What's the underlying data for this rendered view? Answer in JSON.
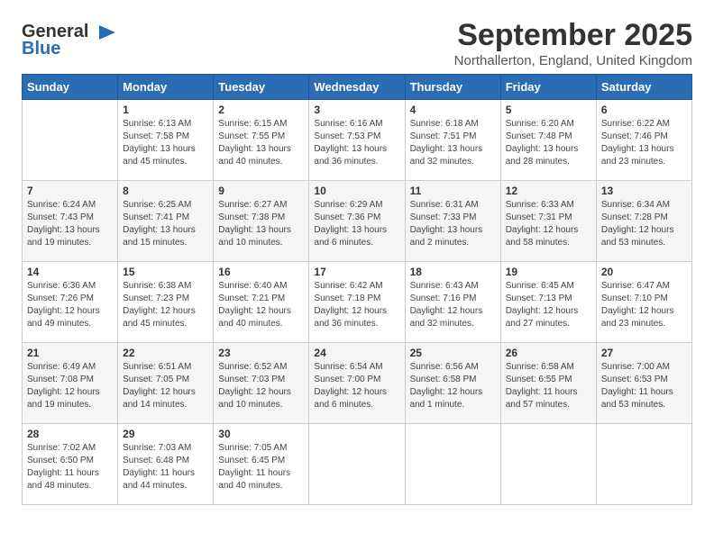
{
  "header": {
    "logo_general": "General",
    "logo_blue": "Blue",
    "month_title": "September 2025",
    "location": "Northallerton, England, United Kingdom"
  },
  "days_of_week": [
    "Sunday",
    "Monday",
    "Tuesday",
    "Wednesday",
    "Thursday",
    "Friday",
    "Saturday"
  ],
  "weeks": [
    [
      {
        "day": "",
        "sunrise": "",
        "sunset": "",
        "daylight": ""
      },
      {
        "day": "1",
        "sunrise": "Sunrise: 6:13 AM",
        "sunset": "Sunset: 7:58 PM",
        "daylight": "Daylight: 13 hours and 45 minutes."
      },
      {
        "day": "2",
        "sunrise": "Sunrise: 6:15 AM",
        "sunset": "Sunset: 7:55 PM",
        "daylight": "Daylight: 13 hours and 40 minutes."
      },
      {
        "day": "3",
        "sunrise": "Sunrise: 6:16 AM",
        "sunset": "Sunset: 7:53 PM",
        "daylight": "Daylight: 13 hours and 36 minutes."
      },
      {
        "day": "4",
        "sunrise": "Sunrise: 6:18 AM",
        "sunset": "Sunset: 7:51 PM",
        "daylight": "Daylight: 13 hours and 32 minutes."
      },
      {
        "day": "5",
        "sunrise": "Sunrise: 6:20 AM",
        "sunset": "Sunset: 7:48 PM",
        "daylight": "Daylight: 13 hours and 28 minutes."
      },
      {
        "day": "6",
        "sunrise": "Sunrise: 6:22 AM",
        "sunset": "Sunset: 7:46 PM",
        "daylight": "Daylight: 13 hours and 23 minutes."
      }
    ],
    [
      {
        "day": "7",
        "sunrise": "Sunrise: 6:24 AM",
        "sunset": "Sunset: 7:43 PM",
        "daylight": "Daylight: 13 hours and 19 minutes."
      },
      {
        "day": "8",
        "sunrise": "Sunrise: 6:25 AM",
        "sunset": "Sunset: 7:41 PM",
        "daylight": "Daylight: 13 hours and 15 minutes."
      },
      {
        "day": "9",
        "sunrise": "Sunrise: 6:27 AM",
        "sunset": "Sunset: 7:38 PM",
        "daylight": "Daylight: 13 hours and 10 minutes."
      },
      {
        "day": "10",
        "sunrise": "Sunrise: 6:29 AM",
        "sunset": "Sunset: 7:36 PM",
        "daylight": "Daylight: 13 hours and 6 minutes."
      },
      {
        "day": "11",
        "sunrise": "Sunrise: 6:31 AM",
        "sunset": "Sunset: 7:33 PM",
        "daylight": "Daylight: 13 hours and 2 minutes."
      },
      {
        "day": "12",
        "sunrise": "Sunrise: 6:33 AM",
        "sunset": "Sunset: 7:31 PM",
        "daylight": "Daylight: 12 hours and 58 minutes."
      },
      {
        "day": "13",
        "sunrise": "Sunrise: 6:34 AM",
        "sunset": "Sunset: 7:28 PM",
        "daylight": "Daylight: 12 hours and 53 minutes."
      }
    ],
    [
      {
        "day": "14",
        "sunrise": "Sunrise: 6:36 AM",
        "sunset": "Sunset: 7:26 PM",
        "daylight": "Daylight: 12 hours and 49 minutes."
      },
      {
        "day": "15",
        "sunrise": "Sunrise: 6:38 AM",
        "sunset": "Sunset: 7:23 PM",
        "daylight": "Daylight: 12 hours and 45 minutes."
      },
      {
        "day": "16",
        "sunrise": "Sunrise: 6:40 AM",
        "sunset": "Sunset: 7:21 PM",
        "daylight": "Daylight: 12 hours and 40 minutes."
      },
      {
        "day": "17",
        "sunrise": "Sunrise: 6:42 AM",
        "sunset": "Sunset: 7:18 PM",
        "daylight": "Daylight: 12 hours and 36 minutes."
      },
      {
        "day": "18",
        "sunrise": "Sunrise: 6:43 AM",
        "sunset": "Sunset: 7:16 PM",
        "daylight": "Daylight: 12 hours and 32 minutes."
      },
      {
        "day": "19",
        "sunrise": "Sunrise: 6:45 AM",
        "sunset": "Sunset: 7:13 PM",
        "daylight": "Daylight: 12 hours and 27 minutes."
      },
      {
        "day": "20",
        "sunrise": "Sunrise: 6:47 AM",
        "sunset": "Sunset: 7:10 PM",
        "daylight": "Daylight: 12 hours and 23 minutes."
      }
    ],
    [
      {
        "day": "21",
        "sunrise": "Sunrise: 6:49 AM",
        "sunset": "Sunset: 7:08 PM",
        "daylight": "Daylight: 12 hours and 19 minutes."
      },
      {
        "day": "22",
        "sunrise": "Sunrise: 6:51 AM",
        "sunset": "Sunset: 7:05 PM",
        "daylight": "Daylight: 12 hours and 14 minutes."
      },
      {
        "day": "23",
        "sunrise": "Sunrise: 6:52 AM",
        "sunset": "Sunset: 7:03 PM",
        "daylight": "Daylight: 12 hours and 10 minutes."
      },
      {
        "day": "24",
        "sunrise": "Sunrise: 6:54 AM",
        "sunset": "Sunset: 7:00 PM",
        "daylight": "Daylight: 12 hours and 6 minutes."
      },
      {
        "day": "25",
        "sunrise": "Sunrise: 6:56 AM",
        "sunset": "Sunset: 6:58 PM",
        "daylight": "Daylight: 12 hours and 1 minute."
      },
      {
        "day": "26",
        "sunrise": "Sunrise: 6:58 AM",
        "sunset": "Sunset: 6:55 PM",
        "daylight": "Daylight: 11 hours and 57 minutes."
      },
      {
        "day": "27",
        "sunrise": "Sunrise: 7:00 AM",
        "sunset": "Sunset: 6:53 PM",
        "daylight": "Daylight: 11 hours and 53 minutes."
      }
    ],
    [
      {
        "day": "28",
        "sunrise": "Sunrise: 7:02 AM",
        "sunset": "Sunset: 6:50 PM",
        "daylight": "Daylight: 11 hours and 48 minutes."
      },
      {
        "day": "29",
        "sunrise": "Sunrise: 7:03 AM",
        "sunset": "Sunset: 6:48 PM",
        "daylight": "Daylight: 11 hours and 44 minutes."
      },
      {
        "day": "30",
        "sunrise": "Sunrise: 7:05 AM",
        "sunset": "Sunset: 6:45 PM",
        "daylight": "Daylight: 11 hours and 40 minutes."
      },
      {
        "day": "",
        "sunrise": "",
        "sunset": "",
        "daylight": ""
      },
      {
        "day": "",
        "sunrise": "",
        "sunset": "",
        "daylight": ""
      },
      {
        "day": "",
        "sunrise": "",
        "sunset": "",
        "daylight": ""
      },
      {
        "day": "",
        "sunrise": "",
        "sunset": "",
        "daylight": ""
      }
    ]
  ]
}
